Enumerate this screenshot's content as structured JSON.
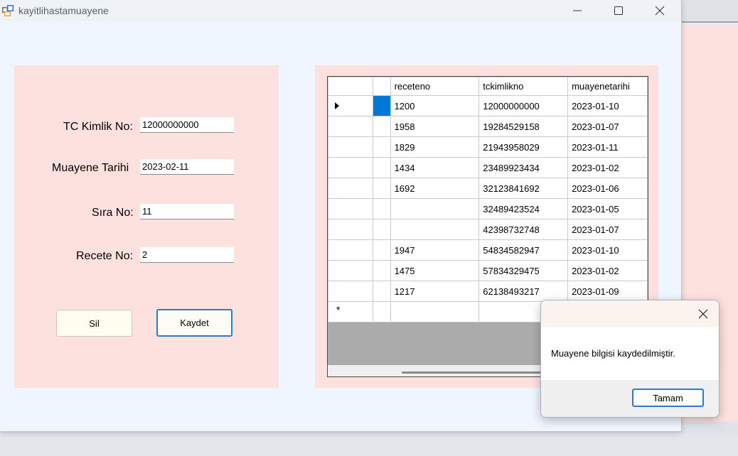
{
  "window": {
    "title": "kayitlihastamuayene"
  },
  "form": {
    "tc_label": "TC Kimlik No:",
    "tc_value": "12000000000",
    "tarih_label": "Muayene Tarihi",
    "tarih_value": "2023-02-11",
    "sira_label": "Sıra No:",
    "sira_value": "11",
    "recete_label": "Recete No:",
    "recete_value": "2",
    "sil_label": "Sil",
    "kaydet_label": "Kaydet"
  },
  "grid": {
    "columns": [
      "receteno",
      "tckimlikno",
      "muayenetarihi"
    ],
    "rows": [
      [
        "1200",
        "12000000000",
        "2023-01-10"
      ],
      [
        "1958",
        "19284529158",
        "2023-01-07"
      ],
      [
        "1829",
        "21943958029",
        "2023-01-11"
      ],
      [
        "1434",
        "23489923434",
        "2023-01-02"
      ],
      [
        "1692",
        "32123841692",
        "2023-01-06"
      ],
      [
        "",
        "32489423524",
        "2023-01-05"
      ],
      [
        "",
        "42398732748",
        "2023-01-07"
      ],
      [
        "1947",
        "54834582947",
        "2023-01-10"
      ],
      [
        "1475",
        "57834329475",
        "2023-01-02"
      ],
      [
        "1217",
        "62138493217",
        "2023-01-09"
      ]
    ],
    "new_row_marker": "*"
  },
  "dialog": {
    "message": "Muayene bilgisi kaydedilmiştir.",
    "ok_label": "Tamam"
  }
}
